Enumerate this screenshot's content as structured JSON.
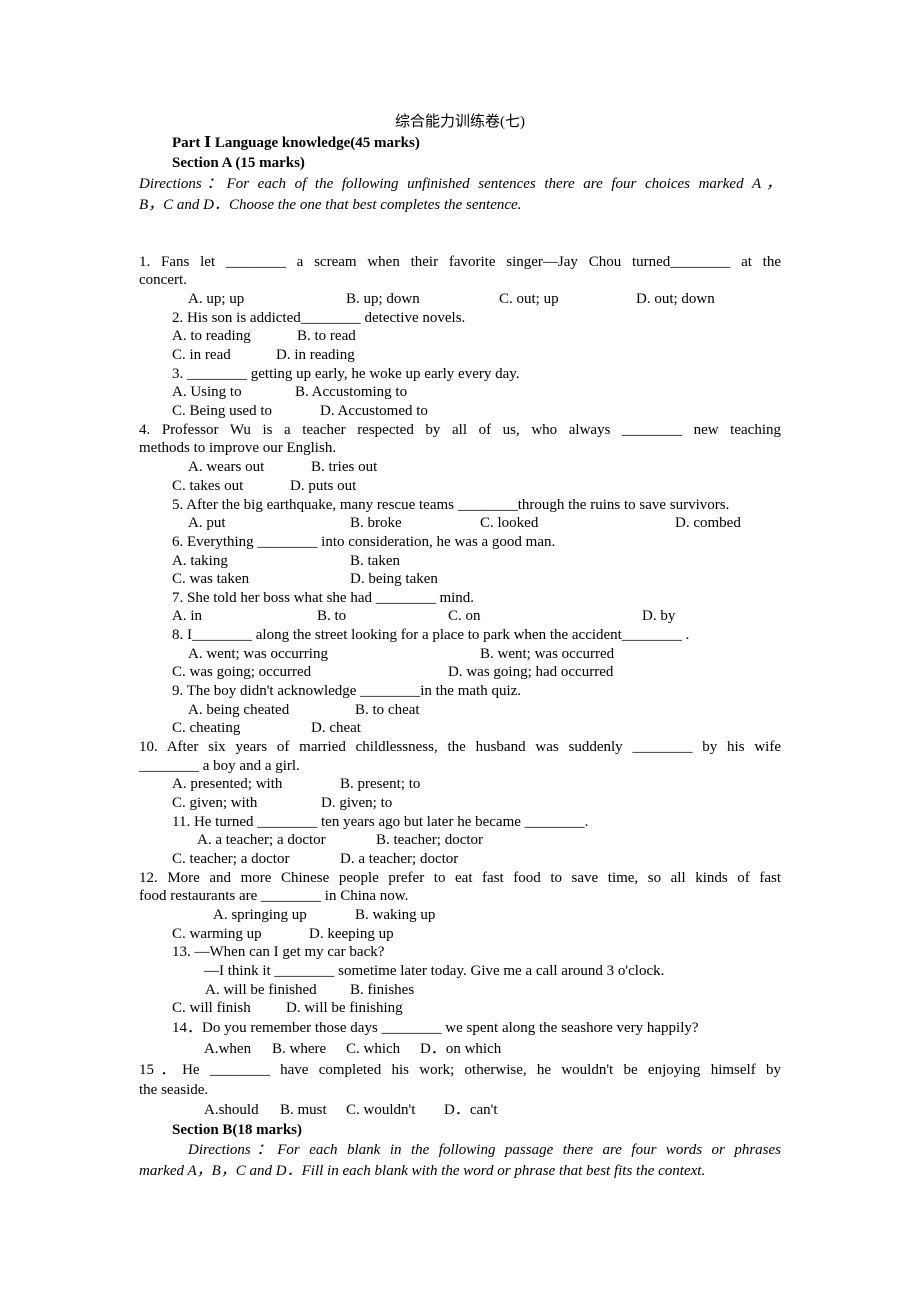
{
  "document": {
    "title": "综合能力训练卷(七)",
    "part_heading": "Part Ⅰ Language knowledge(45 marks)",
    "section_a": {
      "heading": "Section A (15 marks)",
      "directions_line1": "Directions：For each of the following unfinished sentences there are four choices marked A，",
      "directions_line2": "B，C and D．Choose the one that best completes the sentence."
    },
    "questions": [
      {
        "stem_line1": "1. Fans let ________ a scream when their favorite singer—Jay Chou turned________ at the",
        "stem_line2": "concert.",
        "options": [
          "A. up; up",
          "B. up; down",
          "C. out; up",
          "D. out; down"
        ]
      },
      {
        "stem_line1": "2. His son is addicted________ detective novels.",
        "options": [
          "A. to reading",
          "B. to read",
          "C. in read",
          "D. in reading"
        ]
      },
      {
        "stem_line1": "3. ________ getting up early, he woke up early every day.",
        "options": [
          "A. Using to",
          "B. Accustoming to",
          "C. Being used to",
          "D. Accustomed to"
        ]
      },
      {
        "stem_line1": "4. Professor Wu is a teacher respected by all of us, who always ________ new teaching",
        "stem_line2": "methods to improve our English.",
        "options": [
          "A. wears out",
          "B. tries out",
          "C. takes out",
          "D. puts out"
        ]
      },
      {
        "stem_line1": "5. After the big earthquake, many rescue teams ________through the ruins to save survivors.",
        "options": [
          "A. put",
          "B. broke",
          "C. looked",
          "D. combed"
        ]
      },
      {
        "stem_line1": "6. Everything ________ into consideration, he was a good man.",
        "options": [
          "A. taking",
          "B. taken",
          "C. was taken",
          "D. being taken"
        ]
      },
      {
        "stem_line1": "7. She told her boss what she had ________ mind.",
        "options": [
          "A. in",
          "B. to",
          "C. on",
          "D. by"
        ]
      },
      {
        "stem_line1": "8. I________ along the street looking for a place to park when the accident________ .",
        "options": [
          "A. went; was occurring",
          "B. went; was occurred",
          "C. was going; occurred",
          "D. was going; had occurred"
        ]
      },
      {
        "stem_line1": "9. The boy didn't acknowledge ________in the math quiz.",
        "options": [
          "A. being cheated",
          "B. to cheat",
          "C. cheating",
          "D. cheat"
        ]
      },
      {
        "stem_line1": "10. After six years of married childlessness, the husband was suddenly ________ by his wife",
        "stem_line2": "________ a boy and a girl.",
        "options": [
          "A. presented; with",
          "B. present; to",
          "C. given; with",
          "D. given; to"
        ]
      },
      {
        "stem_line1": "11. He turned ________ ten years ago but later he became ________.",
        "options": [
          "A. a teacher; a doctor",
          "B. teacher; doctor",
          "C. teacher; a doctor",
          "D. a teacher; doctor"
        ]
      },
      {
        "stem_line1": "12. More and more Chinese people prefer to eat fast food to save time, so all kinds of fast",
        "stem_line2": "food restaurants are ________ in China now.",
        "options": [
          "A. springing up",
          "B. waking up",
          "C. warming up",
          "D. keeping up"
        ]
      },
      {
        "stem_line1": "13. —When can I get my car back?",
        "stem_line2": "—I think it ________ sometime later today. Give me a call around 3 o'clock.",
        "options": [
          "A. will be finished",
          "B. finishes",
          "C. will finish",
          "D. will be finishing"
        ]
      },
      {
        "stem_line1": "14．Do you remember those days ________ we spent along the seashore very happily?",
        "options": [
          "A.when",
          "B. where",
          "C. which",
          "D．on which"
        ]
      },
      {
        "stem_line1": "15．He ________ have completed his work; otherwise, he wouldn't be enjoying himself by",
        "stem_line2": "the seaside.",
        "options": [
          "A.should",
          "B. must",
          "C. wouldn't",
          "D．can't"
        ]
      }
    ],
    "section_b": {
      "heading": "Section B(18 marks)",
      "directions_line1": "Directions：For each blank in the following passage there are four words or phrases",
      "directions_line2": "marked A，B，C and D．Fill in each blank with the word or phrase that best fits the context."
    }
  }
}
